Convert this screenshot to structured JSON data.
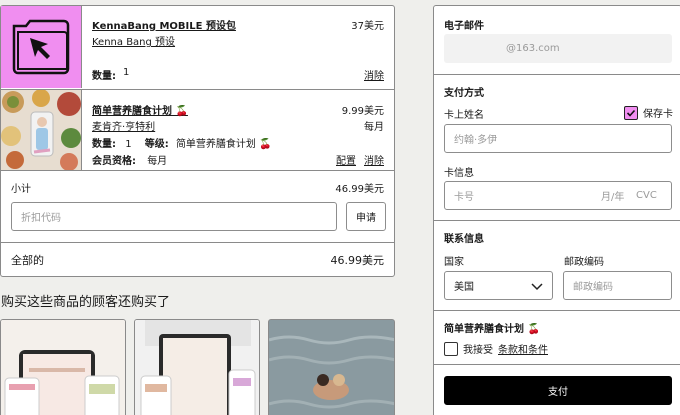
{
  "cart": {
    "items": [
      {
        "title": "KennaBang MOBILE 预设包",
        "author": "Kenna Bang 预设",
        "price": "37美元",
        "qty_label": "数量:",
        "qty": "1",
        "remove": "消除"
      },
      {
        "title": "简单营养膳食计划 🍒",
        "author": "麦肯齐·亨特利",
        "price": "9.99美元",
        "period": "每月",
        "qty_label": "数量:",
        "qty": "1",
        "tier_label": "等级:",
        "tier_value": "简单营养膳食计划 🍒",
        "membership_label": "会员资格:",
        "membership_value": "每月",
        "configure": "配置",
        "remove": "消除"
      }
    ],
    "subtotal_label": "小计",
    "subtotal_value": "46.99美元",
    "discount_placeholder": "折扣代码",
    "apply_label": "申请",
    "total_label": "全部的",
    "total_value": "46.99美元"
  },
  "recommendations": {
    "title": "购买这些商品的顾客还购买了"
  },
  "checkout": {
    "email_label": "电子邮件",
    "email_value": "@163.com",
    "payment_title": "支付方式",
    "name_label": "卡上姓名",
    "save_card_label": "保存卡",
    "name_placeholder": "约翰·多伊",
    "card_info_label": "卡信息",
    "card_number_placeholder": "卡号",
    "expiry_placeholder": "月/年",
    "cvc_placeholder": "CVC",
    "contact_title": "联系信息",
    "country_label": "国家",
    "country_value": "美国",
    "postal_label": "邮政编码",
    "postal_placeholder": "邮政编码",
    "plan_title": "简单营养膳食计划 🍒",
    "accept_label": "我接受",
    "terms_link": "条款和条件",
    "pay_label": "支付"
  },
  "colors": {
    "accent_pink": "#f08ef0",
    "pay_button": "#000000"
  }
}
